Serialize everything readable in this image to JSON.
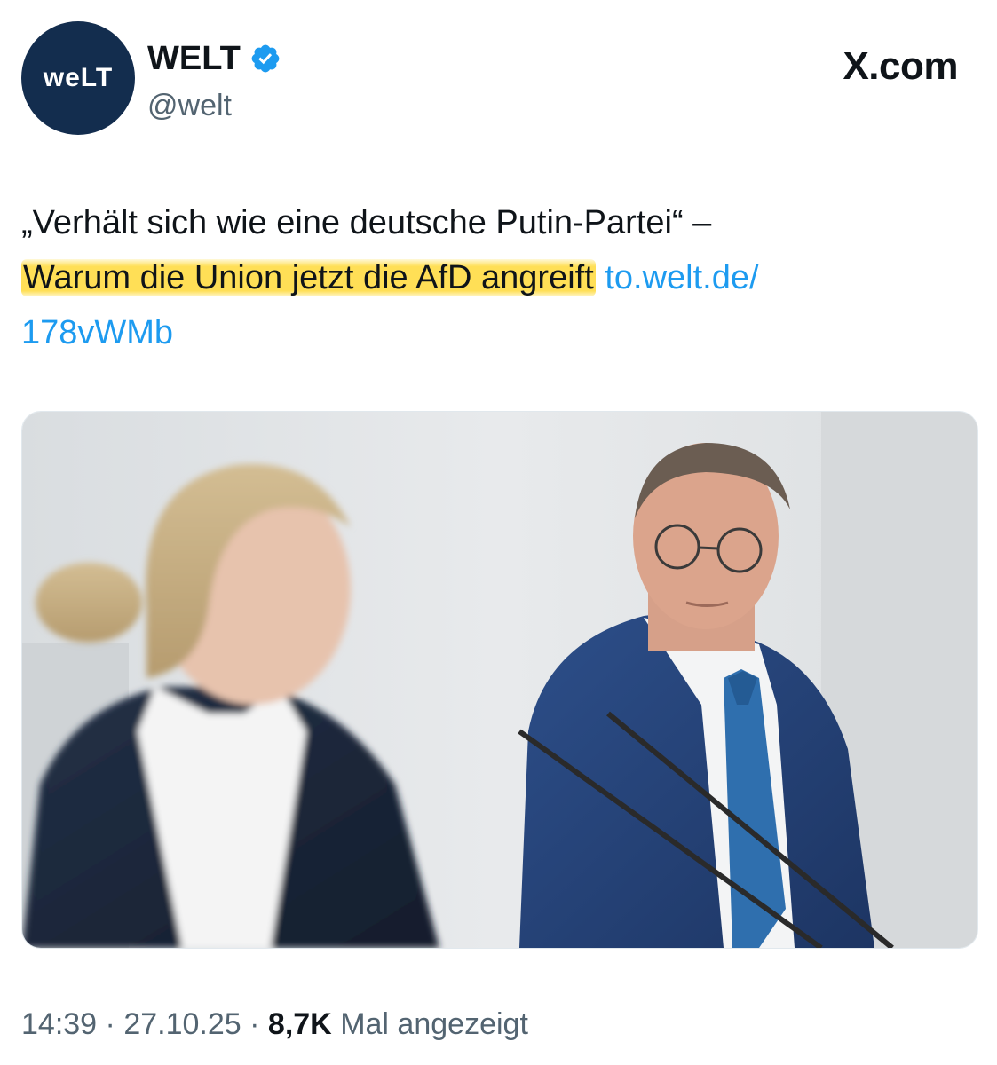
{
  "account": {
    "avatar_text": "weLT",
    "display_name": "WELT",
    "handle": "@welt",
    "verified": true
  },
  "brand": {
    "label": "X.com"
  },
  "tweet": {
    "text_line1": "„Verhält sich wie eine deutsche Putin-Partei“ –",
    "highlighted_text": "Warum die Union jetzt die AfD angreift",
    "link_text": "to.welt.de/178vWMb",
    "link_part1": "to.welt.de/",
    "link_part2": "178vWMb"
  },
  "media": {
    "icon": "photo-of-two-politicians"
  },
  "meta": {
    "time": "14:39",
    "separator": "·",
    "date": "27.10.25",
    "views_count": "8,7K",
    "views_label": "Mal angezeigt"
  },
  "colors": {
    "link": "#1d9bf0",
    "highlight": "#ffd41e",
    "avatar_bg": "#132d4e",
    "verified": "#1d9bf0",
    "muted": "#536471"
  }
}
